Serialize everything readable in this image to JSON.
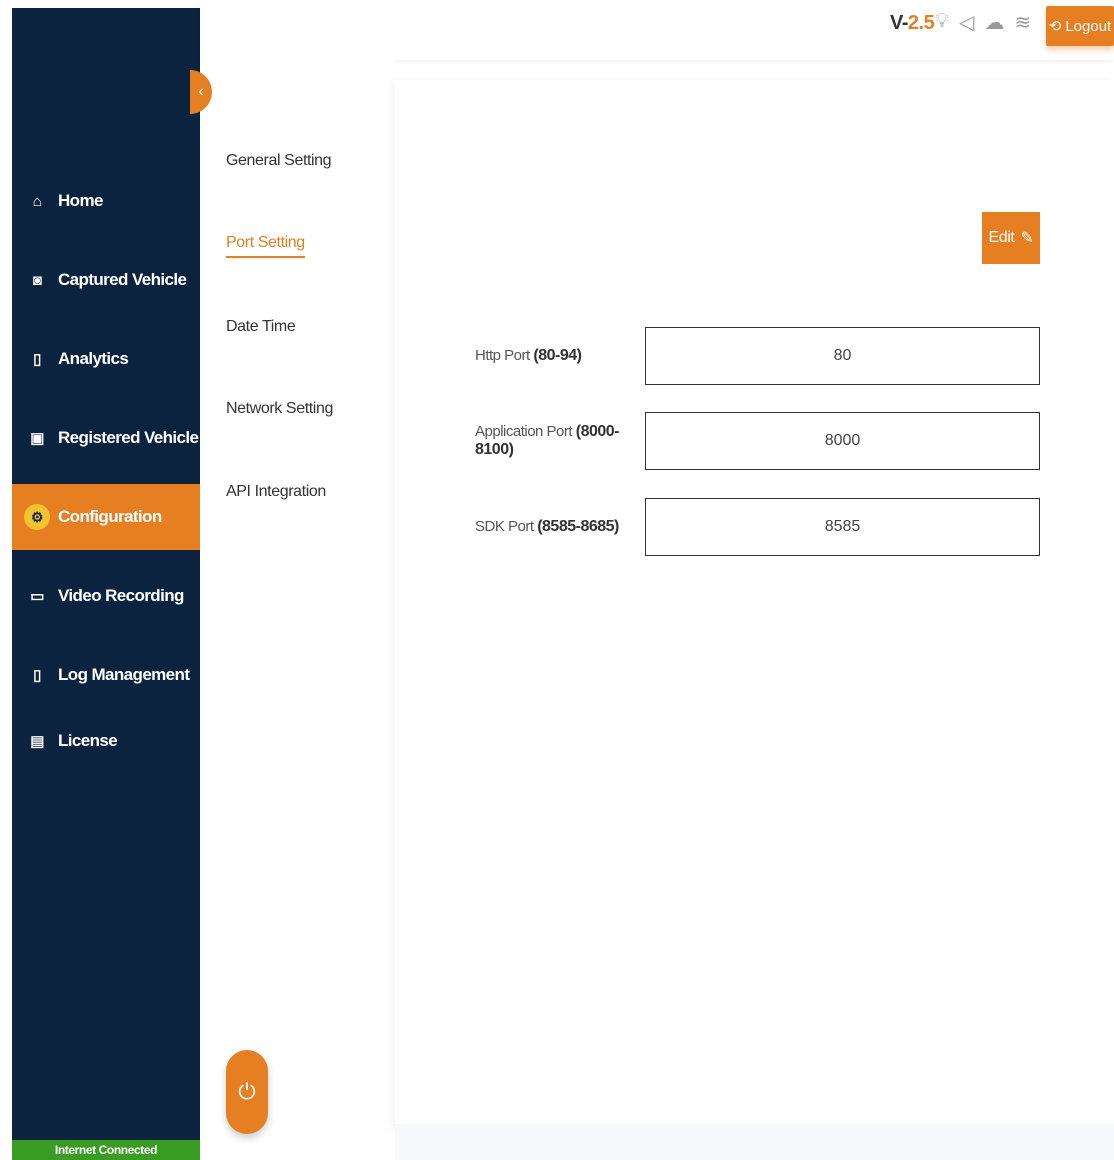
{
  "topbar": {
    "version_prefix": "V-",
    "version_number": "2.5",
    "logout_label": "Logout",
    "icons": [
      "bulb-icon",
      "speaker-icon",
      "cloud-icon",
      "wifi-icon"
    ]
  },
  "sidebar": {
    "items": [
      {
        "label": "Home",
        "icon": "home-icon"
      },
      {
        "label": "Captured Vehicle",
        "icon": "camera-icon"
      },
      {
        "label": "Analytics",
        "icon": "phone-icon"
      },
      {
        "label": "Registered Vehicle",
        "icon": "bus-icon"
      },
      {
        "label": "Configuration",
        "icon": "gear-icon",
        "active": true
      },
      {
        "label": "Video Recording",
        "icon": "video-icon"
      },
      {
        "label": "Log Management",
        "icon": "document-icon"
      },
      {
        "label": "License",
        "icon": "license-icon"
      }
    ],
    "status": "Internet Connected"
  },
  "submenu": {
    "items": [
      {
        "label": "General Setting"
      },
      {
        "label": "Port Setting",
        "active": true
      },
      {
        "label": "Date Time"
      },
      {
        "label": "Network Setting"
      },
      {
        "label": "API Integration"
      }
    ]
  },
  "main": {
    "edit_label": "Edit",
    "fields": [
      {
        "label": "Http Port",
        "range": "(80-94)",
        "value": "80"
      },
      {
        "label": "Application Port",
        "range": "(8000-8100)",
        "value": "8000"
      },
      {
        "label": "SDK Port",
        "range": "(8585-8685)",
        "value": "8585"
      }
    ]
  },
  "colors": {
    "sidebar_bg": "#0c2340",
    "accent": "#e67e22",
    "status_green": "#3a9d23"
  }
}
